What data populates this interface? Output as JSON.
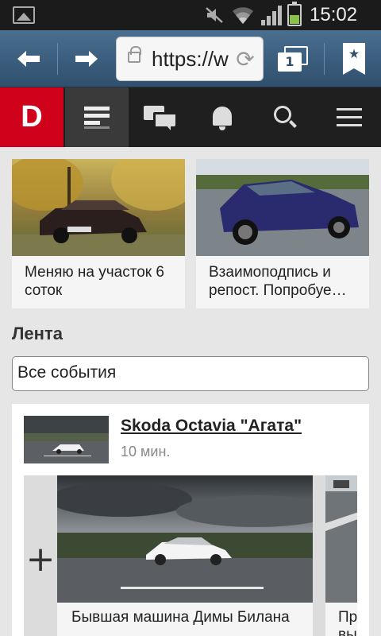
{
  "status_bar": {
    "time": "15:02",
    "icons": [
      "gallery-icon",
      "mute-icon",
      "wifi-icon",
      "signal-icon",
      "battery-icon"
    ],
    "battery_level": 0.45
  },
  "browser": {
    "url": "https://w",
    "tab_count": "1",
    "icons": [
      "back-arrow-icon",
      "forward-arrow-icon",
      "lock-icon",
      "reload-icon",
      "tabs-icon",
      "bookmark-star-icon"
    ]
  },
  "app_nav": {
    "logo": "D",
    "brand_color": "#d0021b",
    "items": [
      {
        "name": "feed",
        "icon": "feed-icon",
        "active": true
      },
      {
        "name": "messages",
        "icon": "chat-icon",
        "active": false
      },
      {
        "name": "notifications",
        "icon": "bell-icon",
        "active": false
      },
      {
        "name": "search",
        "icon": "search-icon",
        "active": false
      },
      {
        "name": "menu",
        "icon": "menu-icon",
        "active": false
      }
    ]
  },
  "cards": [
    {
      "title": "Меняю на участок 6 соток"
    },
    {
      "title": "Взаимоподпись и репост. Попробуе…"
    }
  ],
  "feed": {
    "section_title": "Лента",
    "filter_value": "Все события",
    "post": {
      "title": "Skoda Octavia \"Агата\"",
      "time": "10 мин.",
      "add_label": "+",
      "photos": [
        {
          "caption": "Бывшая машина Димы Билана"
        },
        {
          "caption": "Пр вы"
        }
      ]
    }
  }
}
